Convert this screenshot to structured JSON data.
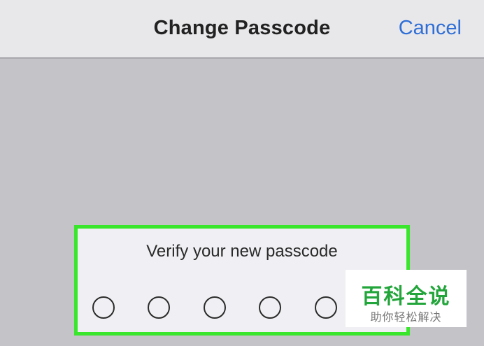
{
  "navbar": {
    "title": "Change Passcode",
    "cancel_label": "Cancel"
  },
  "passcode_panel": {
    "prompt": "Verify your new passcode",
    "digits_total": 6,
    "digits_entered": 0
  },
  "watermark": {
    "brand": "百科全说",
    "tagline": "助你轻松解决"
  },
  "colors": {
    "accent": "#2f6fd6",
    "highlight": "#39e62c",
    "background": "#c4c3c8",
    "watermark_green": "#22a53a"
  }
}
